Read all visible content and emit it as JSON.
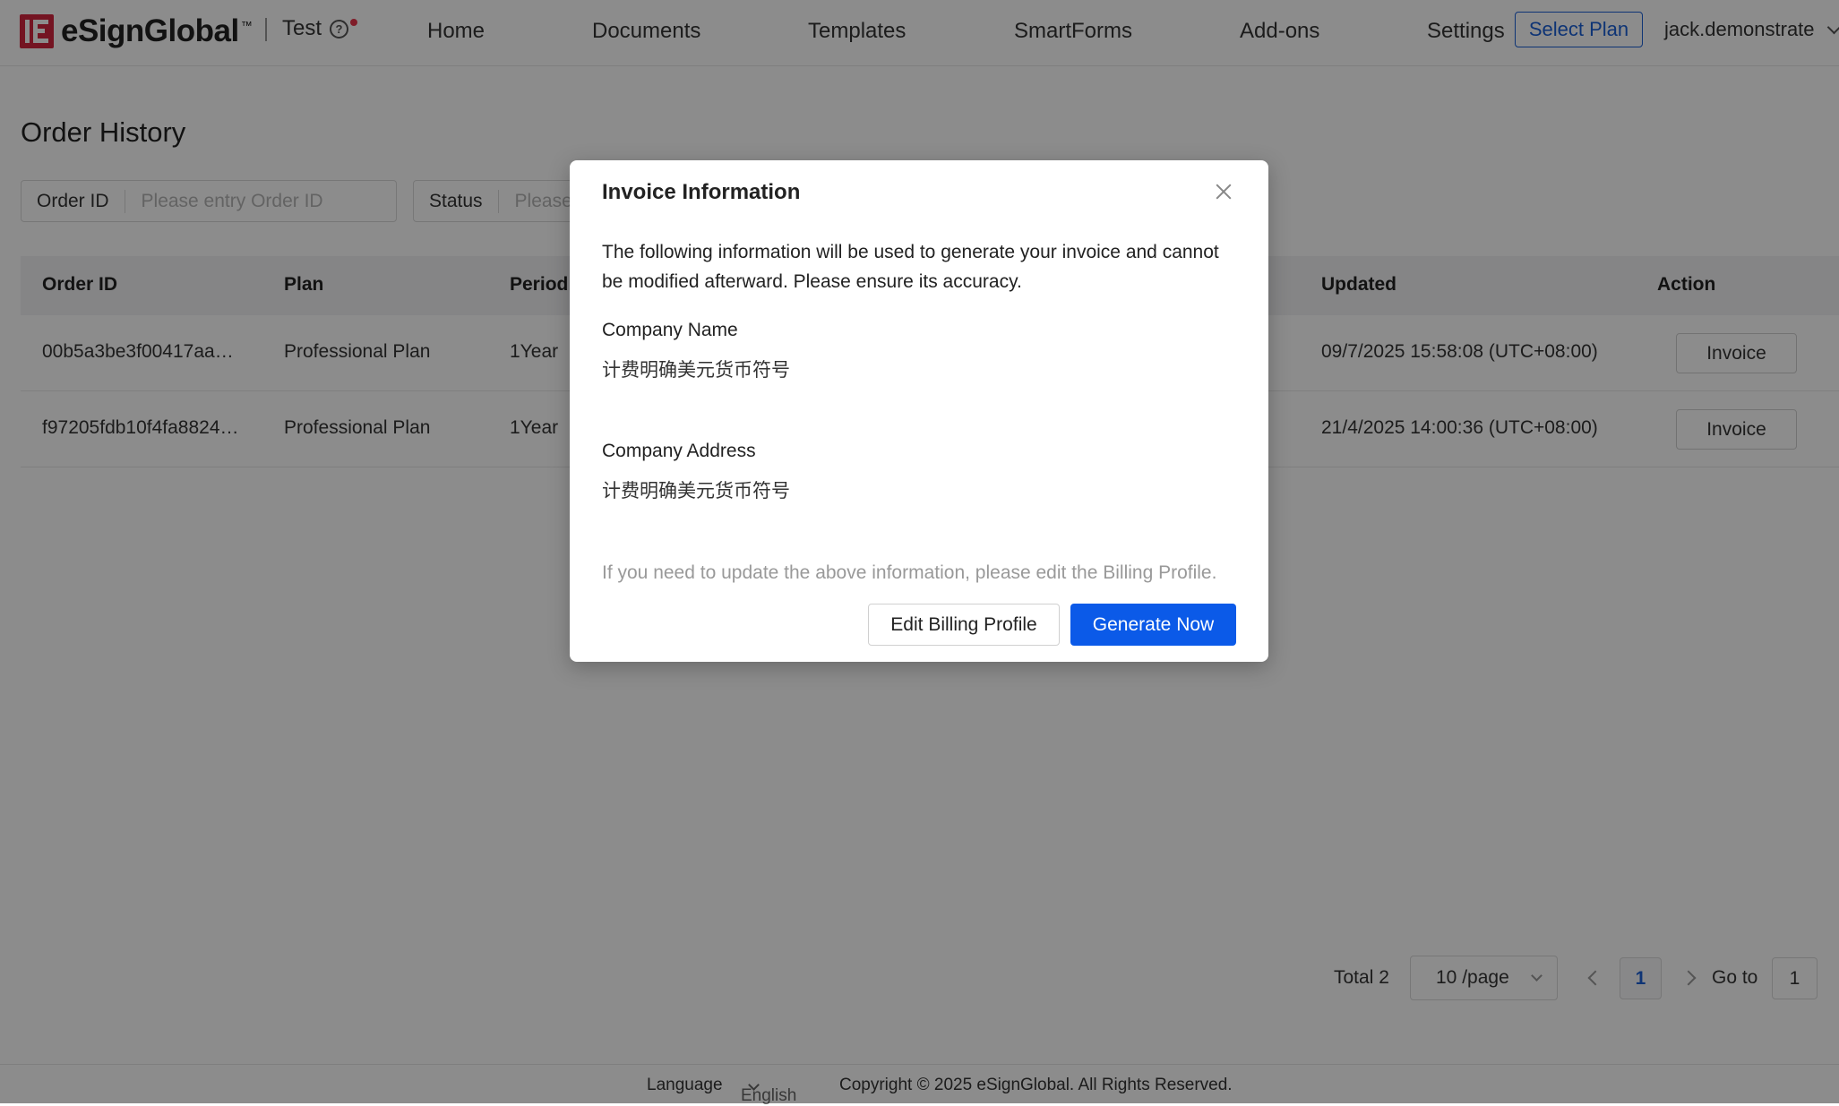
{
  "header": {
    "brand": "eSignGlobal",
    "trademark": "™",
    "workspace": "Test",
    "nav": [
      "Home",
      "Documents",
      "Templates",
      "SmartForms",
      "Add-ons",
      "Settings"
    ],
    "select_plan": "Select Plan",
    "user": "jack.demonstrate"
  },
  "page": {
    "title": "Order History",
    "filters": {
      "order_id_label": "Order ID",
      "order_id_placeholder": "Please entry Order ID",
      "status_label": "Status",
      "status_placeholder": "Please"
    }
  },
  "table": {
    "columns": {
      "order_id": "Order ID",
      "plan": "Plan",
      "period": "Period",
      "updated": "Updated",
      "action": "Action"
    },
    "rows": [
      {
        "order_id": "00b5a3be3f00417aa…",
        "plan": "Professional Plan",
        "period": "1Year",
        "updated": "09/7/2025 15:58:08 (UTC+08:00)",
        "action": "Invoice"
      },
      {
        "order_id": "f97205fdb10f4fa8824…",
        "plan": "Professional Plan",
        "period": "1Year",
        "updated": "21/4/2025 14:00:36 (UTC+08:00)",
        "action": "Invoice"
      }
    ]
  },
  "pagination": {
    "total": "Total 2",
    "page_size": "10 /page",
    "current_page": "1",
    "goto_label": "Go to",
    "goto_value": "1"
  },
  "footer": {
    "language_label": "Language",
    "language_value": "English",
    "copyright": "Copyright © 2025 eSignGlobal. All Rights Reserved."
  },
  "modal": {
    "title": "Invoice Information",
    "description": "The following information will be used to generate your invoice and cannot be modified afterward. Please ensure its accuracy.",
    "company_name_label": "Company Name",
    "company_name_value": "计费明确美元货币符号",
    "company_address_label": "Company Address",
    "company_address_value": "计费明确美元货币符号",
    "hint": "If you need to update the above information, please edit the Billing Profile.",
    "edit_button": "Edit Billing Profile",
    "generate_button": "Generate Now"
  },
  "colors": {
    "brand_red": "#d3263f",
    "primary_blue": "#0b5ae8",
    "overlay": "rgba(0,0,0,0.45)"
  }
}
